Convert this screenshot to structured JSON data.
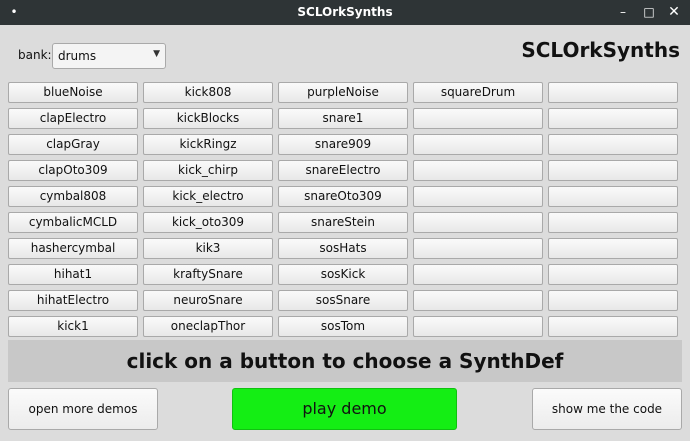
{
  "window": {
    "title": "SCLOrkSynths",
    "menu_glyph": "•",
    "min_glyph": "–",
    "max_glyph": "□",
    "close_glyph": "✕"
  },
  "bank": {
    "label": "bank:",
    "selected": "drums",
    "arrow": "▼"
  },
  "app_title": "SCLOrkSynths",
  "synth_columns": [
    [
      "blueNoise",
      "clapElectro",
      "clapGray",
      "clapOto309",
      "cymbal808",
      "cymbalicMCLD",
      "hashercymbal",
      "hihat1",
      "hihatElectro",
      "kick1"
    ],
    [
      "kick808",
      "kickBlocks",
      "kickRingz",
      "kick_chirp",
      "kick_electro",
      "kick_oto309",
      "kik3",
      "kraftySnare",
      "neuroSnare",
      "oneclapThor"
    ],
    [
      "purpleNoise",
      "snare1",
      "snare909",
      "snareElectro",
      "snareOto309",
      "snareStein",
      "sosHats",
      "sosKick",
      "sosSnare",
      "sosTom"
    ],
    [
      "squareDrum",
      "",
      "",
      "",
      "",
      "",
      "",
      "",
      "",
      ""
    ],
    [
      "",
      "",
      "",
      "",
      "",
      "",
      "",
      "",
      "",
      ""
    ]
  ],
  "info_text": "click on a button to choose a SynthDef",
  "buttons": {
    "open_more_demos": "open more demos",
    "play_demo": "play demo",
    "show_code": "show me the code"
  },
  "colors": {
    "play_button": "#14ee14",
    "titlebar": "#2e3436",
    "background": "#dcdcdc"
  }
}
